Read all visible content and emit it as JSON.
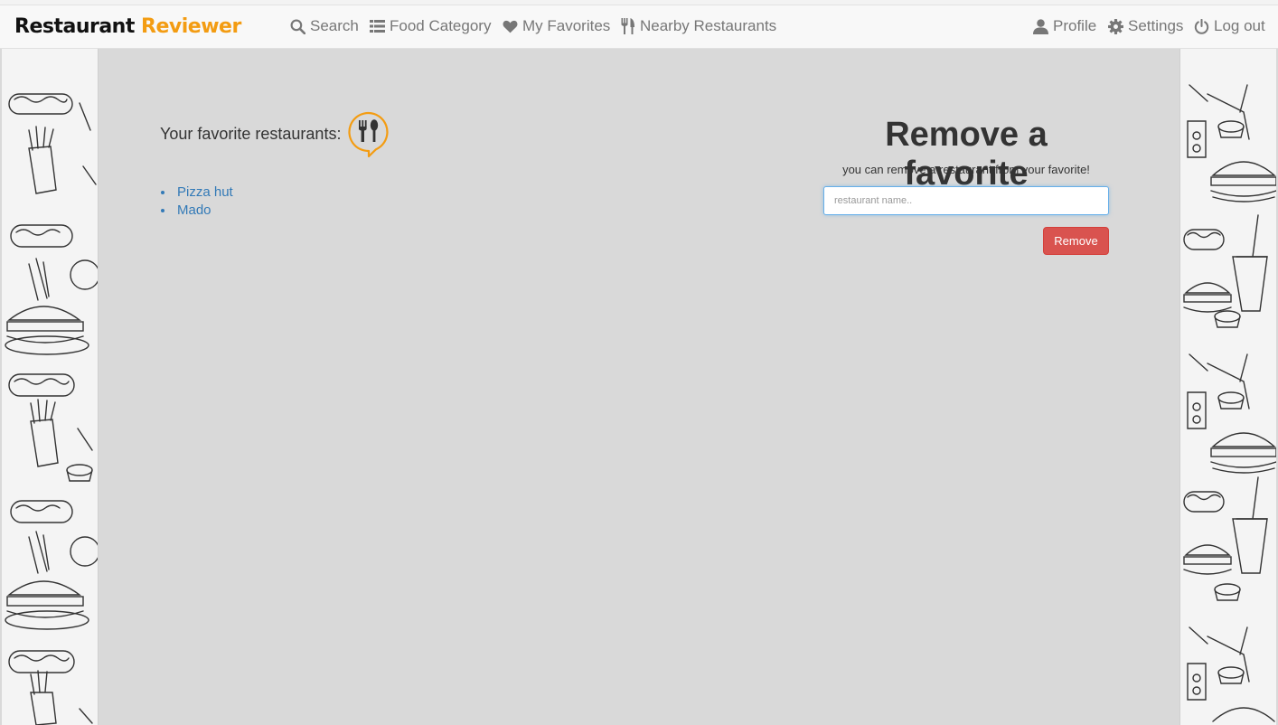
{
  "brand": {
    "part1": "Restaurant",
    "part2": "Reviewer"
  },
  "nav": {
    "search": "Search",
    "food_category": "Food Category",
    "favorites": "My Favorites",
    "nearby": "Nearby Restaurants",
    "profile": "Profile",
    "settings": "Settings",
    "logout": "Log out"
  },
  "favorites": {
    "title": "Your favorite restaurants:",
    "items": [
      "Pizza hut",
      "Mado"
    ]
  },
  "remove": {
    "title": "Remove a favorite",
    "subtitle": "you can remove a restaurant from your favorite!",
    "placeholder": "restaurant name..",
    "value": "",
    "button": "Remove"
  },
  "icons": {
    "search": "search-icon",
    "category": "list-icon",
    "favorites": "heart-icon",
    "nearby": "cutlery-icon",
    "profile": "user-icon",
    "settings": "gear-icon",
    "logout": "power-icon",
    "favorites_header": "fork-spoon-icon"
  },
  "colors": {
    "brand_accent": "#f39c12",
    "link": "#337ab7",
    "danger": "#d9534f",
    "nav_text": "#777777",
    "content_bg": "#d9d9d9"
  }
}
